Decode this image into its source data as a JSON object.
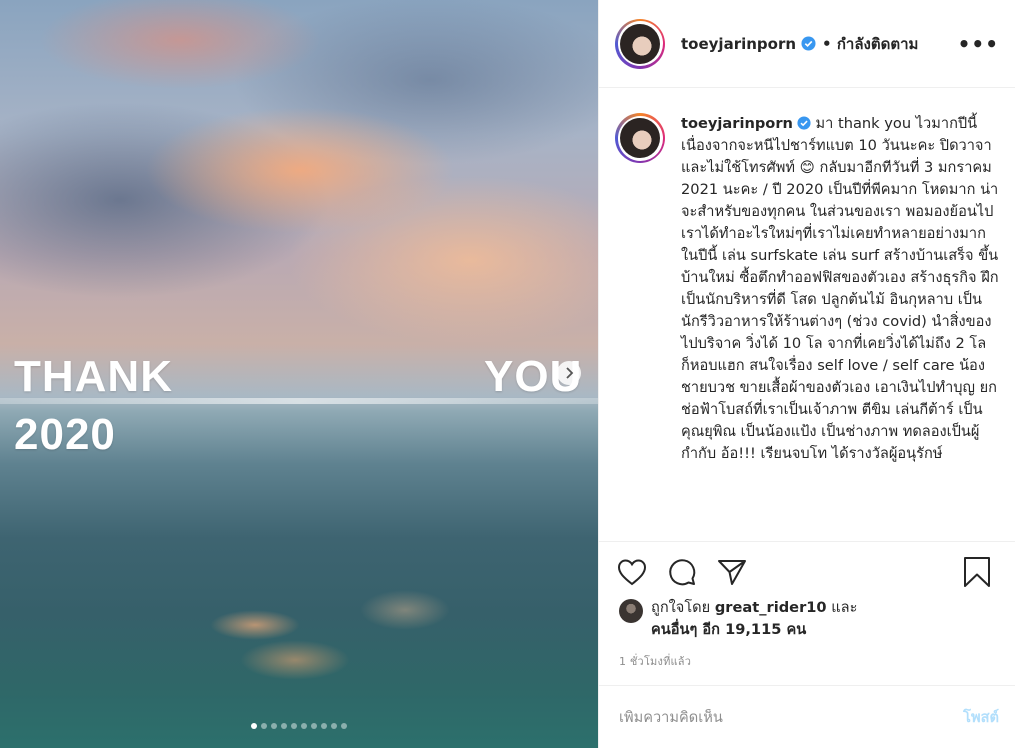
{
  "post": {
    "username": "toeyjarinporn",
    "follow_status": "• กำลังติดตาม",
    "more_label": "•••"
  },
  "media": {
    "text_thank": "THANK",
    "text_year": "2020",
    "text_you": "YOU",
    "slide_count": 10,
    "active_slide": 1
  },
  "caption": {
    "username": "toeyjarinporn",
    "text_a": " มา thank you ไวมากปีนี้ เนื่องจากจะหนีไปชาร์ทแบต 10 วันนะคะ ปิดวาจา และไม่ใช้โทรศัพท์ ",
    "emoji": "😊",
    "text_b": " กลับมาอีกทีวันที่ 3 มกราคม 2021 นะคะ / ปี 2020 เป็นปีที่พีคมาก โหดมาก น่าจะสำหรับของทุกคน ในส่วนของเรา พอมองย้อนไป เราได้ทำอะไรใหม่ๆที่เราไม่เคยทำหลายอย่างมากในปีนี้ เล่น surfskate เล่น surf สร้างบ้านเสร็จ ขึ้นบ้านใหม่ ซื้อตึกทำออฟฟิสของตัวเอง สร้างธุรกิจ ฝึกเป็นนักบริหารที่ดี โสด ปลูกต้นไม้ อินกุหลาบ เป็นนักรีวิวอาหารให้ร้านต่างๆ (ช่วง covid) นำสิ่งของไปบริจาค วิ่งได้ 10 โล จากที่เคยวิ่งได้ไม่ถึง 2 โล ก็หอบแฮก สนใจเรื่อง self love / self care น้องชายบวช ขายเสื้อผ้าของตัวเอง เอาเงินไปทำบุญ ยกช่อฟ้าโบสถ์ที่เราเป็นเจ้าภาพ ตีขิม เล่นกีต้าร์ เป็นคุณยุพิณ เป็นน้องแป้ง เป็นช่างภาพ ทดลองเป็นผู้กำกับ อ้อ!!! เรียนจบโท ได้รางวัลผู้อนุรักษ์"
  },
  "likes": {
    "prefix": "ถูกใจโดย ",
    "liker": "great_rider10",
    "middle": " และ",
    "others": "คนอื่นๆ อีก 19,115 คน"
  },
  "timestamp": "1 ชั่วโมงที่แล้ว",
  "comment": {
    "placeholder": "เพิ่มความคิดเห็น",
    "post_label": "โพสต์"
  },
  "colors": {
    "verified": "#3897f0",
    "post_button": "#b2dffc",
    "muted": "#8e8e8e"
  }
}
